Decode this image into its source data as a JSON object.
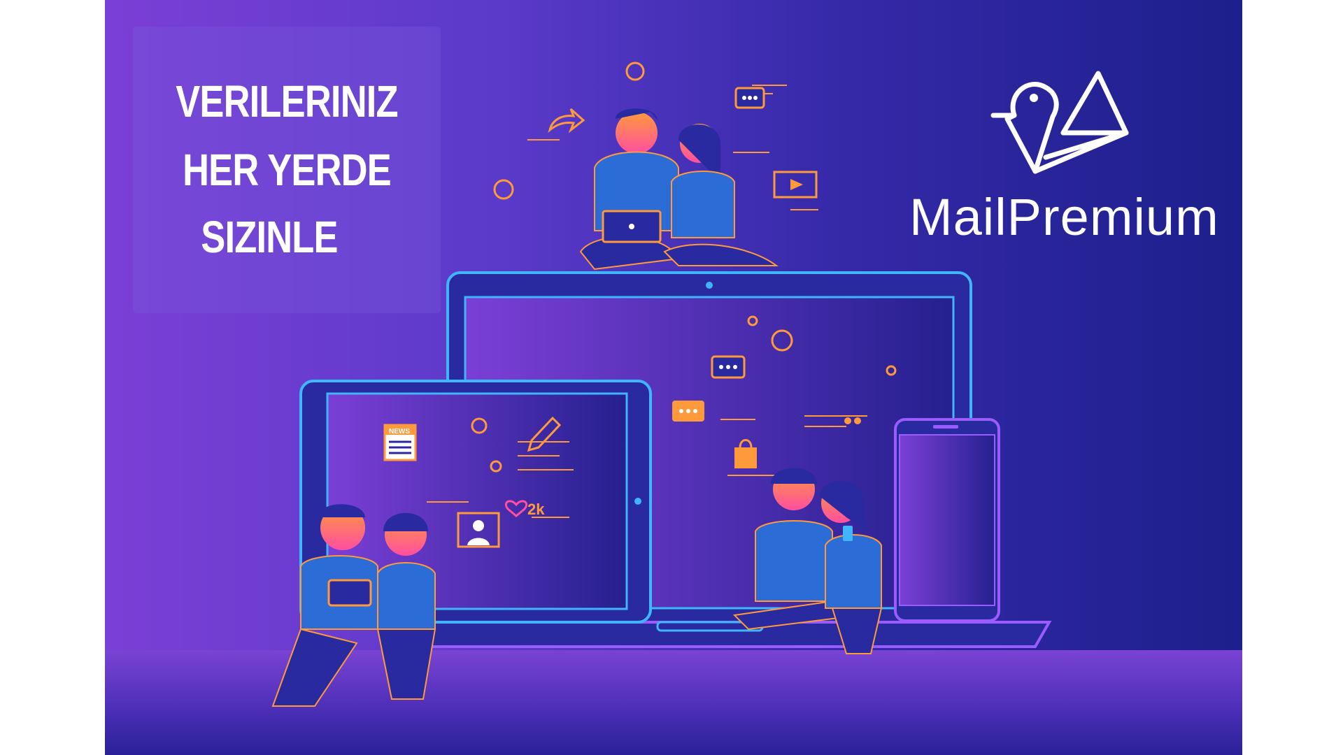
{
  "headline": {
    "line1": "VERILERINIZ",
    "line2": "HER YERDE",
    "line3": "SIZINLE"
  },
  "brand": {
    "name": "MailPremium"
  },
  "badges": {
    "news": "NEWS",
    "likes": "2k"
  },
  "colors": {
    "background_left": "#7b3fd6",
    "background_right": "#1d1f8c",
    "accent_orange": "#ff9a3c",
    "accent_pink": "#ff4fa0",
    "outline_blue": "#3fb6ff",
    "white": "#ffffff"
  },
  "icons": [
    "bird-logo-icon",
    "chat-bubble-icon",
    "video-icon",
    "share-arrow-icon",
    "news-icon",
    "pencil-icon",
    "heart-icon",
    "profile-photo-icon",
    "shopping-bag-icon",
    "quote-icon",
    "laptop-icon",
    "tablet-icon",
    "phone-icon"
  ]
}
